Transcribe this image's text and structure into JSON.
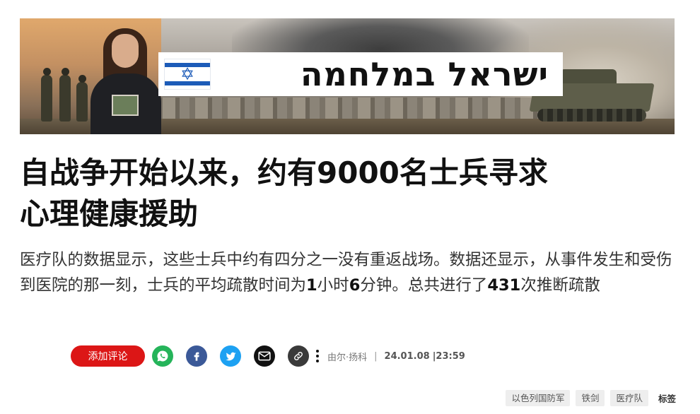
{
  "banner": {
    "title": "ישראל במלחמה",
    "flag_star": "✡"
  },
  "article": {
    "headline_line1": "自战争开始以来，约有9000名士兵寻求",
    "headline_line2": "心理健康援助",
    "lead_part1": "医疗队的数据显示，这些士兵中约有四分之一没有重返战场。数据还显示，从事件发生和受伤到医院的那一刻，士兵的平均疏散时间为",
    "lead_num1": "1",
    "lead_part2": "小时",
    "lead_num2": "6",
    "lead_part3": "分钟。总共进行了",
    "lead_num3": "431",
    "lead_part4": "次推断疏散"
  },
  "share": {
    "comment_label": "添加评论",
    "icons": [
      "whatsapp-icon",
      "facebook-icon",
      "twitter-icon",
      "mail-icon",
      "link-icon"
    ]
  },
  "byline": {
    "author": "由尔·扬科",
    "separator": "|",
    "date": "24.01.08",
    "time": "|23:59"
  },
  "tags": {
    "items": [
      "以色列国防军",
      "铁剑",
      "医疗队"
    ],
    "label": "标签"
  },
  "colors": {
    "comment_button": "#dc1616",
    "whatsapp": "#25b45a",
    "facebook": "#3b5998",
    "twitter": "#1da1f2",
    "flag_blue": "#1c5bb8"
  }
}
